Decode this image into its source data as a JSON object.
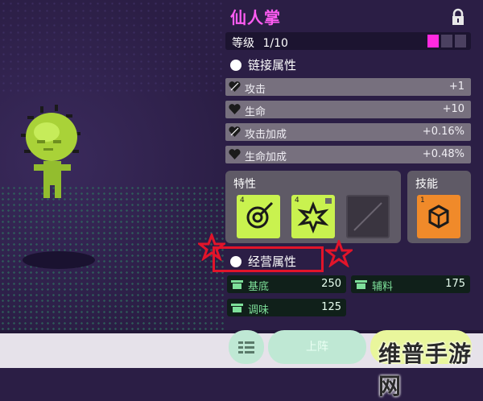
{
  "character": {
    "name": "仙人掌",
    "level_label": "等级",
    "level": "1/10",
    "level_pips_filled": 1,
    "level_pips_total": 3
  },
  "link_attributes": {
    "header": "链接属性",
    "rows": [
      {
        "label": "攻击",
        "value": "+1"
      },
      {
        "label": "生命",
        "value": "+10"
      },
      {
        "label": "攻击加成",
        "value": "+0.16%"
      },
      {
        "label": "生命加成",
        "value": "+0.48%"
      }
    ]
  },
  "traits": {
    "header": "特性",
    "slots": [
      {
        "level": "4",
        "state": "filled"
      },
      {
        "level": "4",
        "state": "locked"
      },
      {
        "level": "",
        "state": "empty"
      }
    ]
  },
  "skills": {
    "header": "技能",
    "slots": [
      {
        "level": "1"
      }
    ]
  },
  "business_attributes": {
    "header": "经营属性",
    "rows": [
      {
        "label": "基底",
        "value": "250"
      },
      {
        "label": "辅料",
        "value": "175"
      },
      {
        "label": "调味",
        "value": "125"
      }
    ]
  },
  "buttons": {
    "deploy": "上阵"
  },
  "watermark": "维普手游网",
  "colors": {
    "title": "#ff5cf2",
    "pip_on": "#ff2ae0",
    "trait_green": "#c9f24f",
    "skill_orange": "#f08a2a",
    "highlight_red": "#e2142a"
  }
}
